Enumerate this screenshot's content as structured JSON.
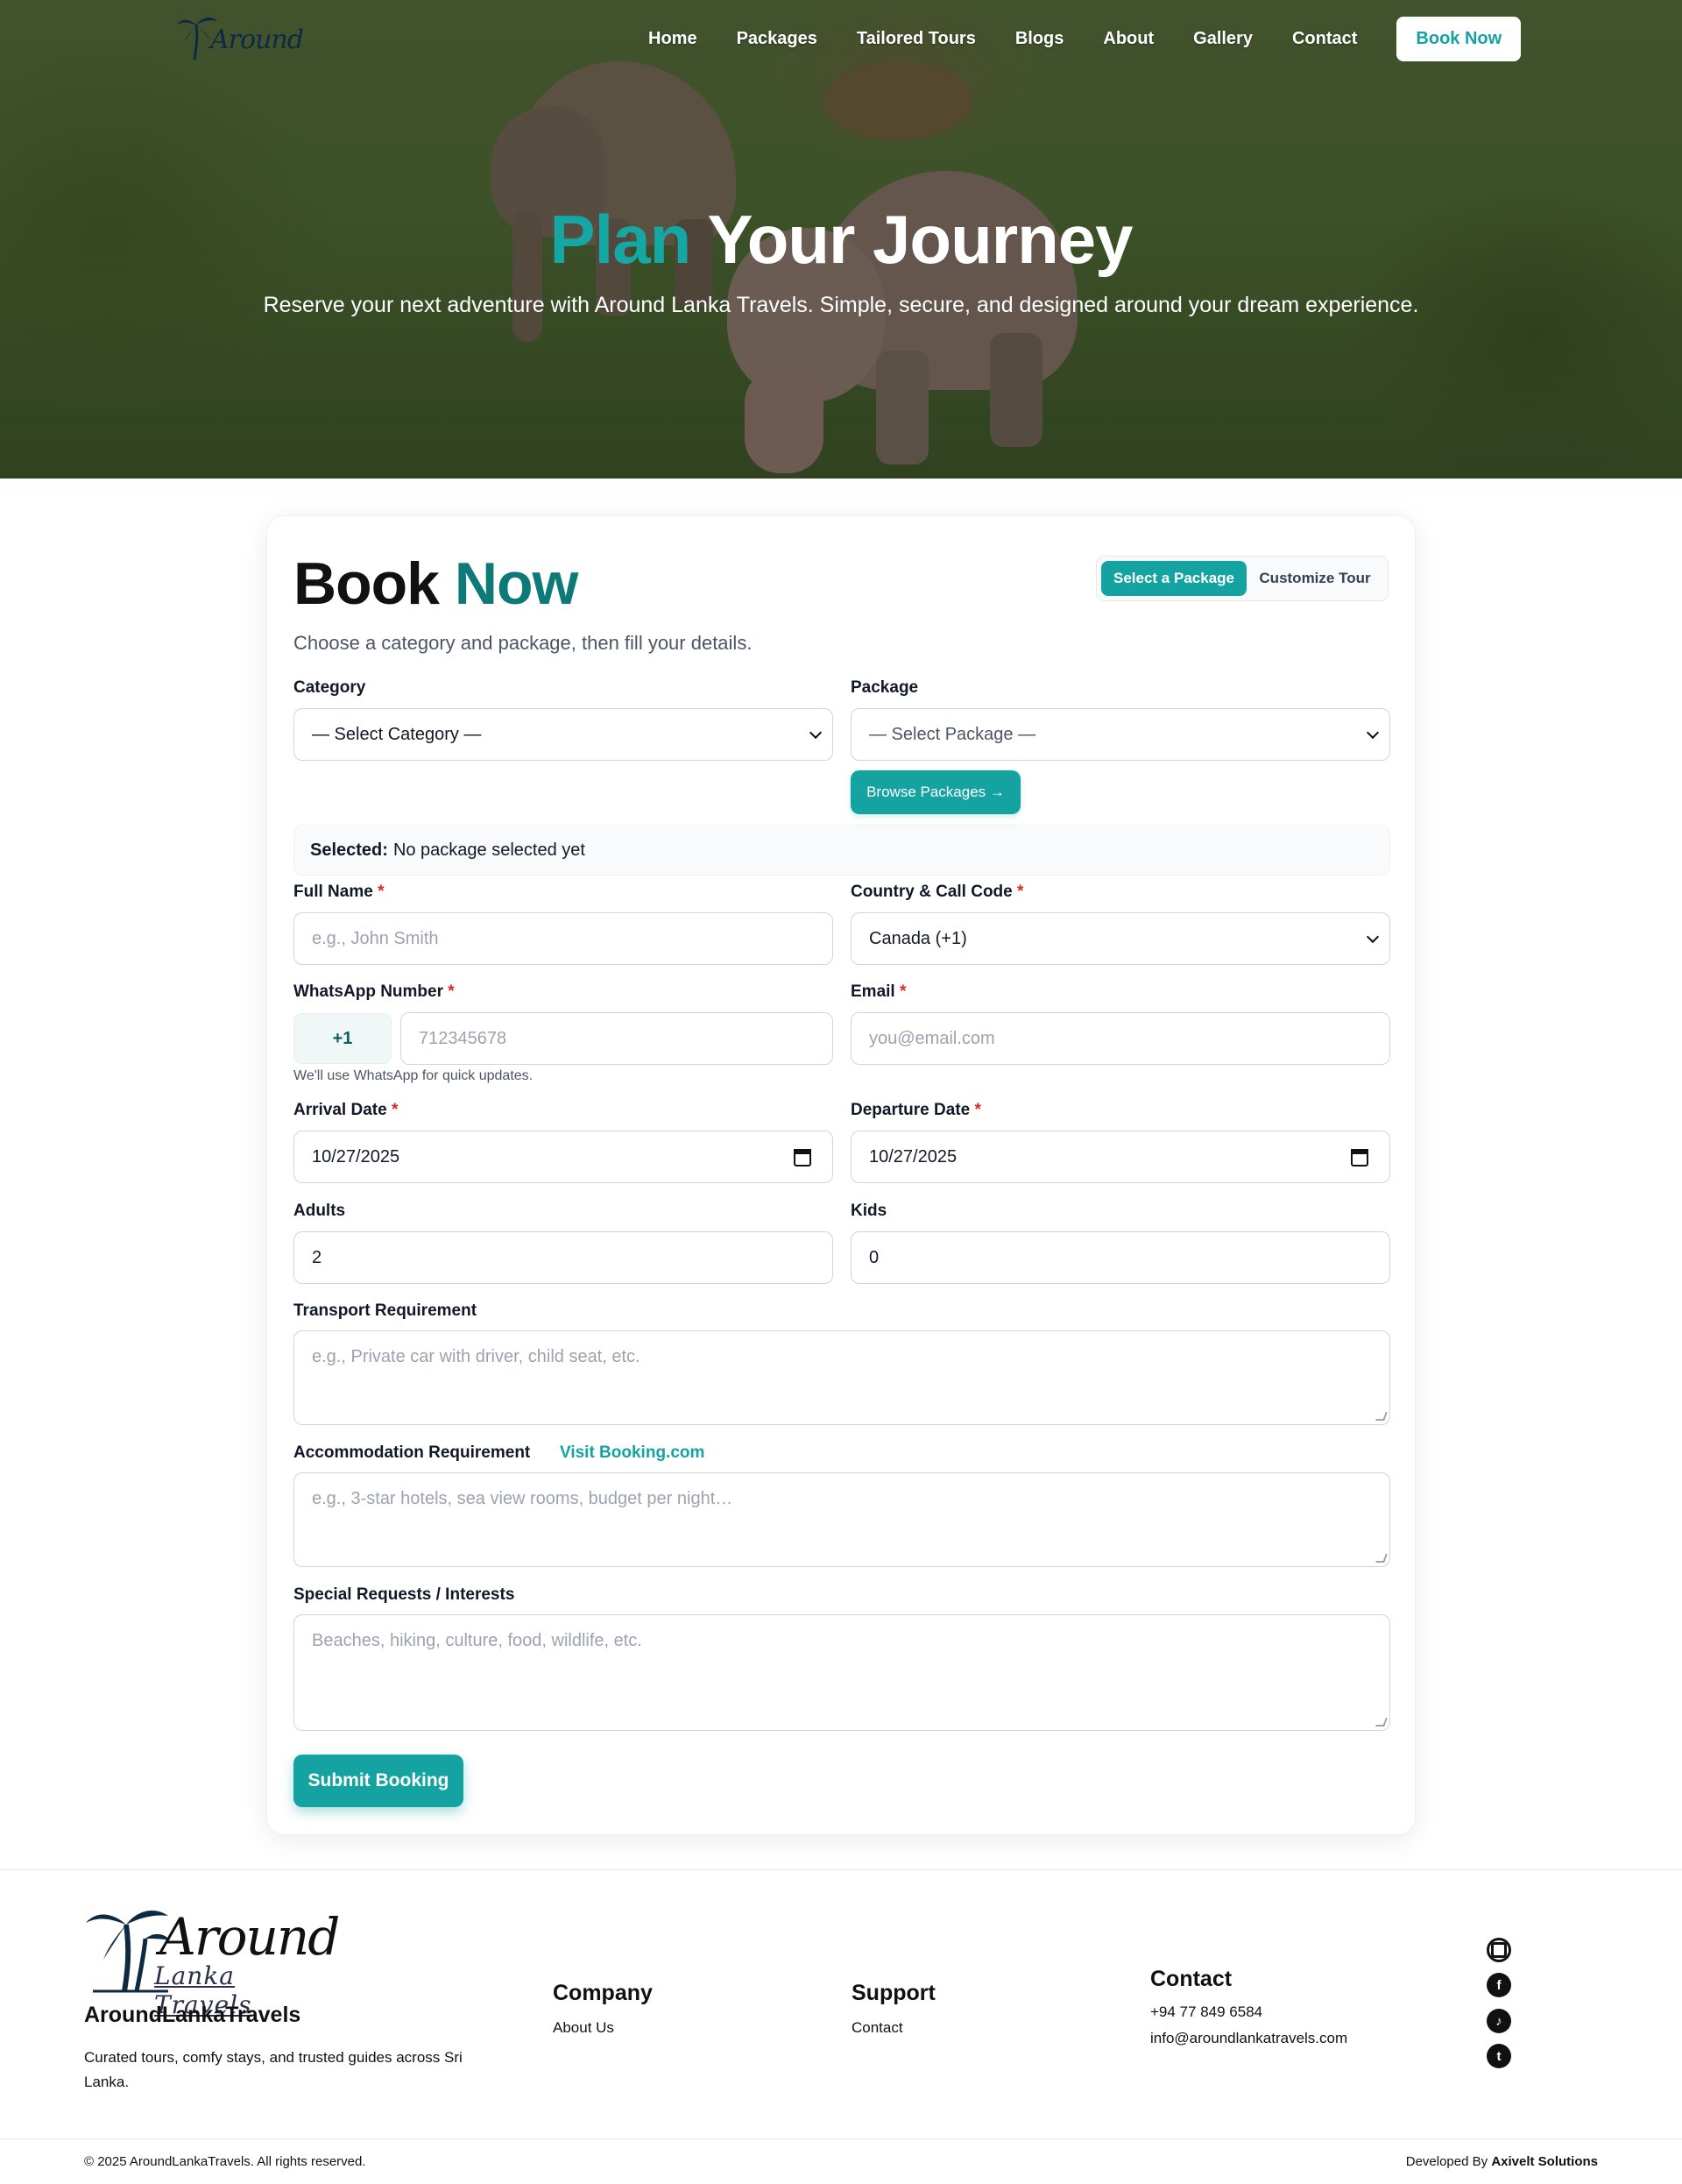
{
  "nav": {
    "items": [
      "Home",
      "Packages",
      "Tailored Tours",
      "Blogs",
      "About",
      "Gallery",
      "Contact"
    ],
    "book_label": "Book Now",
    "logo_text": "Around"
  },
  "hero": {
    "title_accent": "Plan",
    "title_rest": "Your Journey",
    "subtitle": "Reserve your next adventure with Around Lanka Travels. Simple, secure, and designed around your dream experience."
  },
  "booking": {
    "title_main": "Book",
    "title_accent": "Now",
    "mode_select": "Select a Package",
    "mode_custom": "Customize Tour",
    "subtitle": "Choose a category and package, then fill your details.",
    "category_label": "Category",
    "category_value": "— Select Category —",
    "package_label": "Package",
    "package_value": "— Select Package —",
    "browse_label": "Browse Packages →",
    "selected_label": "Selected:",
    "selected_value": "No package selected yet",
    "full_name_label": "Full Name",
    "full_name_placeholder": "e.g., John Smith",
    "country_label": "Country & Call Code",
    "country_value": "Canada (+1)",
    "whatsapp_label": "WhatsApp Number",
    "whatsapp_code": "+1",
    "whatsapp_placeholder": "712345678",
    "whatsapp_hint": "We'll use WhatsApp for quick updates.",
    "email_label": "Email",
    "email_placeholder": "you@email.com",
    "arrival_label": "Arrival Date",
    "arrival_value": "10/27/2025",
    "departure_label": "Departure Date",
    "departure_value": "10/27/2025",
    "adults_label": "Adults",
    "adults_value": "2",
    "kids_label": "Kids",
    "kids_value": "0",
    "transport_label": "Transport Requirement",
    "transport_placeholder": "e.g., Private car with driver, child seat, etc.",
    "accommodation_label": "Accommodation Requirement",
    "booking_link": "Visit Booking.com",
    "accommodation_placeholder": "e.g., 3-star hotels, sea view rooms, budget per night…",
    "special_label": "Special Requests / Interests",
    "special_placeholder": "Beaches, hiking, culture, food, wildlife, etc.",
    "submit_label": "Submit Booking",
    "required_mark": "*"
  },
  "footer": {
    "logo_line1": "Around",
    "logo_line2": "Lanka Travels",
    "brand": "AroundLankaTravels",
    "description": "Curated tours, comfy stays, and trusted guides across Sri Lanka.",
    "company_heading": "Company",
    "company_link": "About Us",
    "support_heading": "Support",
    "support_link": "Contact",
    "contact_heading": "Contact",
    "phone": "+94 77 849 6584",
    "email": "info@aroundlankatravels.com",
    "socials": [
      "instagram-icon",
      "facebook-icon",
      "tiktok-icon",
      "tumblr-icon"
    ],
    "copyright": "© 2025 AroundLankaTravels. All rights reserved.",
    "developed_prefix": "Developed By",
    "developer": "Axivelt Solutions"
  },
  "colors": {
    "accent": "#14a3a0",
    "accent_dark": "#0e7a78",
    "required": "#dc2626"
  }
}
